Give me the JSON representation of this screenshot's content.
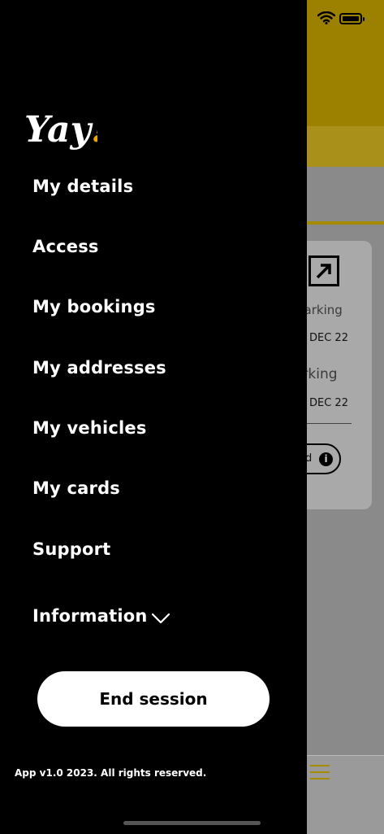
{
  "brand": {
    "logo_text": "Yay!"
  },
  "menu": {
    "items": [
      {
        "label": "My details"
      },
      {
        "label": "Access"
      },
      {
        "label": "My bookings"
      },
      {
        "label": "My addresses"
      },
      {
        "label": "My vehicles"
      },
      {
        "label": "My cards"
      },
      {
        "label": "Support"
      }
    ],
    "information_label": "Information"
  },
  "end_session_label": "End session",
  "footer": "App v1.0 2023. All rights reserved.",
  "background": {
    "parking_1": "parking",
    "date_1": "DEC 22",
    "parking_2": "arking",
    "date_2": "DEC 22",
    "pill_text": "d",
    "info_glyph": "i"
  },
  "colors": {
    "drawer_bg": "#000000",
    "accent_yellow": "#f2a400",
    "button_bg": "#ffffff"
  }
}
